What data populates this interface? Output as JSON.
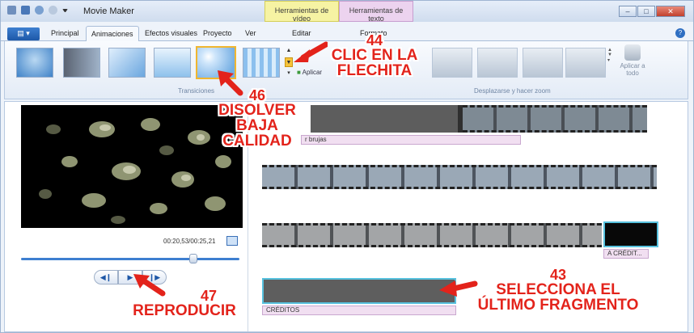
{
  "window": {
    "title": "Movie Maker",
    "context_tabs": [
      "Herramientas de vídeo",
      "Herramientas de texto"
    ],
    "context_subtabs": [
      "Editar",
      "Formato"
    ],
    "min": "–",
    "max": "□",
    "close": "✕"
  },
  "tabs": [
    "Principal",
    "Animaciones",
    "Efectos visuales",
    "Proyecto",
    "Ver"
  ],
  "ribbon": {
    "group_transitions": "Transiciones",
    "group_pan": "Desplazarse y hacer zoom",
    "apply_small": "Aplicar",
    "apply_big": "Aplicar a todo"
  },
  "preview": {
    "time": "00:20,53/00:25,21"
  },
  "timeline": {
    "label_brujas": "r brujas",
    "label_credit": "A CRÉDIT...",
    "label_creditos": "CRÉDITOS"
  },
  "annotations": {
    "a44_num": "44",
    "a44_l1": "CLIC EN LA",
    "a44_l2": "FLECHITA",
    "a46_num": "46",
    "a46_l1": "DISOLVER",
    "a46_l2": "BAJA",
    "a46_l3": "CALIDAD",
    "a43_num": "43",
    "a43_l1": "SELECCIONA EL",
    "a43_l2": "ÚLTIMO FRAGMENTO",
    "a47_num": "47",
    "a47_l1": "REPRODUCIR"
  },
  "colors": {
    "accent": "#3e7fd0",
    "annotation_red": "#e3231b",
    "selected_outline": "#57c1de"
  },
  "seek_fraction": 0.79
}
